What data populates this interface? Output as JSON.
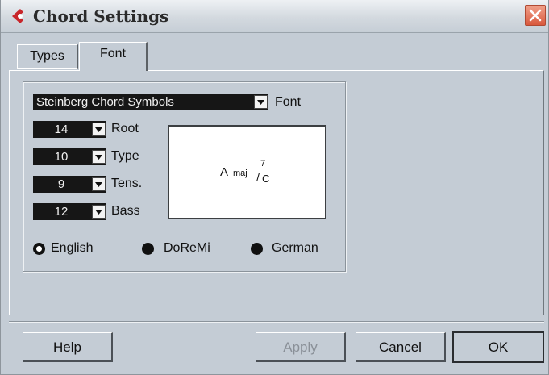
{
  "window": {
    "title": "Chord Settings"
  },
  "tabs": [
    {
      "label": "Types"
    },
    {
      "label": "Font"
    }
  ],
  "font_panel": {
    "font_dropdown": {
      "value": "Steinberg Chord Symbols",
      "label": "Font"
    },
    "sizes": [
      {
        "value": "14",
        "label": "Root"
      },
      {
        "value": "10",
        "label": "Type"
      },
      {
        "value": "9",
        "label": "Tens."
      },
      {
        "value": "12",
        "label": "Bass"
      }
    ],
    "preview": {
      "root": "A",
      "type": "maj",
      "tension": "7",
      "bass": "C"
    },
    "naming": [
      {
        "label": "English",
        "selected": true
      },
      {
        "label": "DoReMi",
        "selected": false
      },
      {
        "label": "German",
        "selected": false
      }
    ]
  },
  "buttons": {
    "help": "Help",
    "apply": "Apply",
    "cancel": "Cancel",
    "ok": "OK"
  },
  "colors": {
    "dialog_bg": "#c4ccd5",
    "field_bg": "#161616",
    "close_button": "#d9583d",
    "app_icon": "#c8262b"
  }
}
